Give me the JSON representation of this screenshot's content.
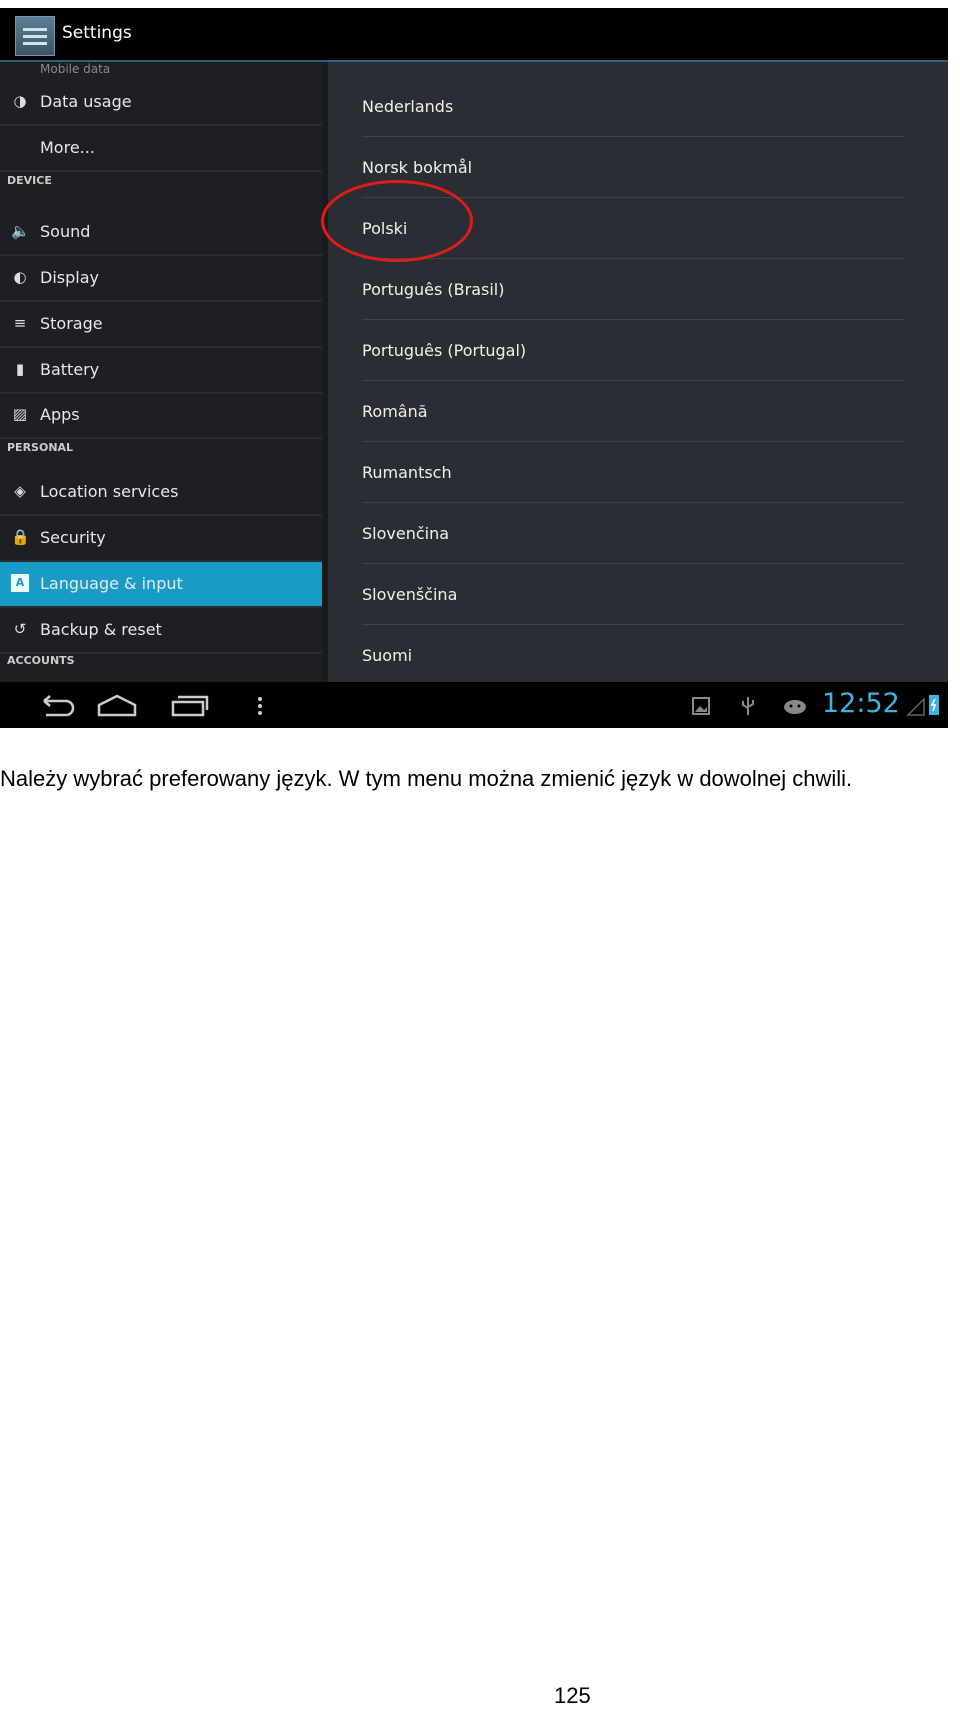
{
  "app": {
    "title": "Settings"
  },
  "sidebar": {
    "partial_item": "Mobile data",
    "items": [
      {
        "type": "item",
        "label": "Data usage",
        "icon": "data-usage-icon",
        "glyph": "◑"
      },
      {
        "type": "item",
        "label": "More...",
        "icon": "",
        "glyph": ""
      },
      {
        "type": "header",
        "label": "DEVICE"
      },
      {
        "type": "item",
        "label": "Sound",
        "icon": "sound-icon",
        "glyph": "🔈"
      },
      {
        "type": "item",
        "label": "Display",
        "icon": "display-icon",
        "glyph": "◐"
      },
      {
        "type": "item",
        "label": "Storage",
        "icon": "storage-icon",
        "glyph": "≡"
      },
      {
        "type": "item",
        "label": "Battery",
        "icon": "battery-icon",
        "glyph": "▮"
      },
      {
        "type": "item",
        "label": "Apps",
        "icon": "apps-icon",
        "glyph": "▨"
      },
      {
        "type": "header",
        "label": "PERSONAL"
      },
      {
        "type": "item",
        "label": "Location services",
        "icon": "location-icon",
        "glyph": "◈"
      },
      {
        "type": "item",
        "label": "Security",
        "icon": "lock-icon",
        "glyph": "🔒"
      },
      {
        "type": "item",
        "label": "Language & input",
        "icon": "language-icon",
        "glyph": "A",
        "active": true
      },
      {
        "type": "item",
        "label": "Backup & reset",
        "icon": "backup-icon",
        "glyph": "↺"
      },
      {
        "type": "header",
        "label": "ACCOUNTS"
      }
    ]
  },
  "languages": [
    "Nederlands",
    "Norsk bokmål",
    "Polski",
    "Português (Brasil)",
    "Português (Portugal)",
    "Română",
    "Rumantsch",
    "Slovenčina",
    "Slovenščina",
    "Suomi"
  ],
  "highlighted_language": "Polski",
  "status_bar": {
    "time": "12:52",
    "icons": [
      "gallery-icon",
      "usb-icon",
      "android-icon",
      "signal-icon",
      "battery-icon"
    ]
  },
  "colors": {
    "accent": "#1a9bc6",
    "highlight_circle": "#e01b1b",
    "clock": "#3fb3e0"
  },
  "document": {
    "text": "Należy wybrać preferowany język. W tym menu można zmienić język w dowolnej chwili.",
    "page_number": "125"
  }
}
